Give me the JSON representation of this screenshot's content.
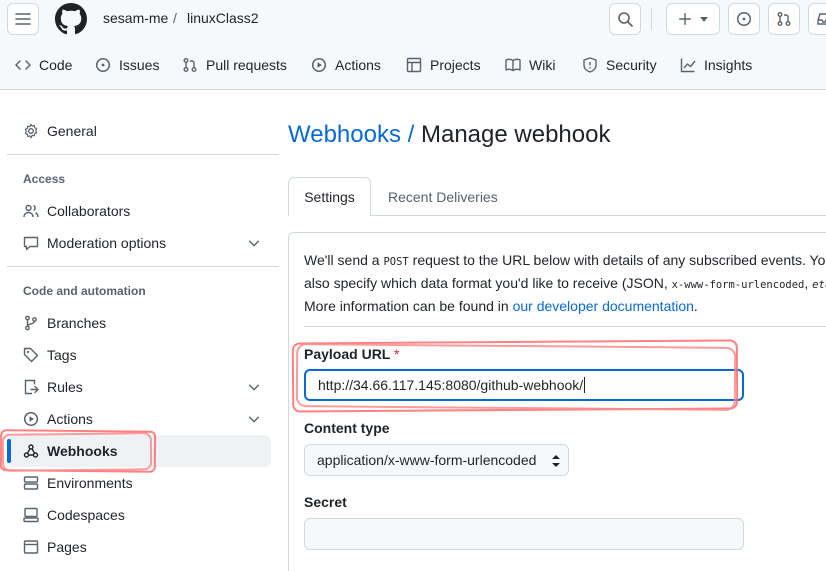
{
  "header": {
    "owner": "sesam-me",
    "separator": "/",
    "repo": "linuxClass2"
  },
  "repo_tabs": [
    {
      "label": "Code",
      "icon": "code-icon"
    },
    {
      "label": "Issues",
      "icon": "issue-icon"
    },
    {
      "label": "Pull requests",
      "icon": "pull-request-icon"
    },
    {
      "label": "Actions",
      "icon": "play-icon"
    },
    {
      "label": "Projects",
      "icon": "table-icon"
    },
    {
      "label": "Wiki",
      "icon": "book-icon"
    },
    {
      "label": "Security",
      "icon": "shield-icon"
    },
    {
      "label": "Insights",
      "icon": "graph-icon"
    }
  ],
  "sidebar": {
    "general": "General",
    "access_heading": "Access",
    "collaborators": "Collaborators",
    "moderation": "Moderation options",
    "code_heading": "Code and automation",
    "branches": "Branches",
    "tags": "Tags",
    "rules": "Rules",
    "actions": "Actions",
    "webhooks": "Webhooks",
    "environments": "Environments",
    "codespaces": "Codespaces",
    "pages": "Pages"
  },
  "main": {
    "title_link": "Webhooks",
    "title_sep": " / ",
    "title_rest": "Manage webhook",
    "tab_settings": "Settings",
    "tab_recent": "Recent Deliveries",
    "para_l1_a": "We'll send a ",
    "para_l1_code": "POST",
    "para_l1_b": " request to the URL below with details of any subscribed events. You",
    "para_l2_a": "also specify which data format you'd like to receive (JSON, ",
    "para_l2_code": "x-www-form-urlencoded",
    "para_l2_b": ", ",
    "para_l2_c": "etc",
    "para_l3_a": "More information can be found in ",
    "para_l3_link": "our developer documentation",
    "para_l3_b": ".",
    "payload_label": "Payload URL",
    "required_mark": "*",
    "payload_value": "http://34.66.117.145:8080/github-webhook/",
    "content_type_label": "Content type",
    "content_type_value": "application/x-www-form-urlencoded",
    "secret_label": "Secret",
    "secret_value": ""
  },
  "colors": {
    "accent": "#0969da",
    "annotation": "#ff6b6b"
  }
}
